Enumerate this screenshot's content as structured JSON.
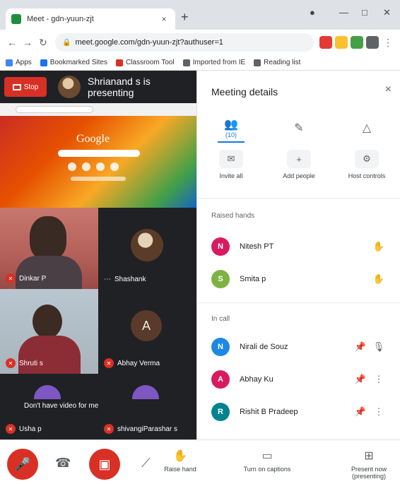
{
  "browser": {
    "tab_title": "Meet - gdn-yuun-zjt",
    "tab_close": "×",
    "new_tab": "+",
    "address": "meet.google.com/gdn-yuun-zjt?authuser=1",
    "bookmarks": [
      {
        "label": "Apps",
        "color": "#4285f4"
      },
      {
        "label": "Bookmarked Sites",
        "color": "#1a73e8"
      },
      {
        "label": "Classroom Tool",
        "color": "#d93025"
      },
      {
        "label": "Imported from IE",
        "color": "#5f6368"
      },
      {
        "label": "Reading list",
        "color": "#5f6368"
      }
    ]
  },
  "presentation": {
    "button_label": "Stop",
    "text": "Shrianand s is presenting"
  },
  "shared_screen": {
    "logo_text": "Google"
  },
  "tiles": [
    {
      "name": "Dinkar P",
      "muted": true
    },
    {
      "name": "Shashank",
      "muted": false
    },
    {
      "name": "Shruti s",
      "muted": true
    },
    {
      "name": "Abhay Verma",
      "initial": "A",
      "muted": true
    },
    {
      "name": "Usha p",
      "caption": "Don't have video for meeting",
      "muted": true
    },
    {
      "name": "shivangiParashar s",
      "muted": true
    }
  ],
  "panel": {
    "title": "Meeting details",
    "close": "×",
    "tabs": [
      {
        "label": "People",
        "count": "(10)",
        "icon": "people-icon"
      },
      {
        "label": "Chat",
        "icon": "chat-icon"
      },
      {
        "label": "Activities",
        "icon": "activities-icon"
      }
    ],
    "actions": [
      {
        "label": "Invite all",
        "icon": "invite-icon"
      },
      {
        "label": "Add people",
        "icon": "add-person-icon"
      },
      {
        "label": "Host controls",
        "icon": "host-controls-icon"
      }
    ],
    "section_raised": "Raised hands",
    "raised": [
      {
        "name": "Nitesh PT",
        "initial": "N",
        "color": "#d81b60"
      },
      {
        "name": "Smita p",
        "initial": "S",
        "color": "#7cb342"
      }
    ],
    "section_all": "In call",
    "people": [
      {
        "name": "Nirali de Souz",
        "initial": "N",
        "color": "#1e88e5"
      },
      {
        "name": "Abhay Ku",
        "initial": "A",
        "color": "#d81b60"
      },
      {
        "name": "Rishit B Pradeep",
        "initial": "R",
        "color": "#00838f"
      }
    ]
  },
  "bottom": {
    "raise_hand": "Raise hand",
    "turn_on_captions": "Turn on captions",
    "present_now": "Present now (presenting)"
  }
}
